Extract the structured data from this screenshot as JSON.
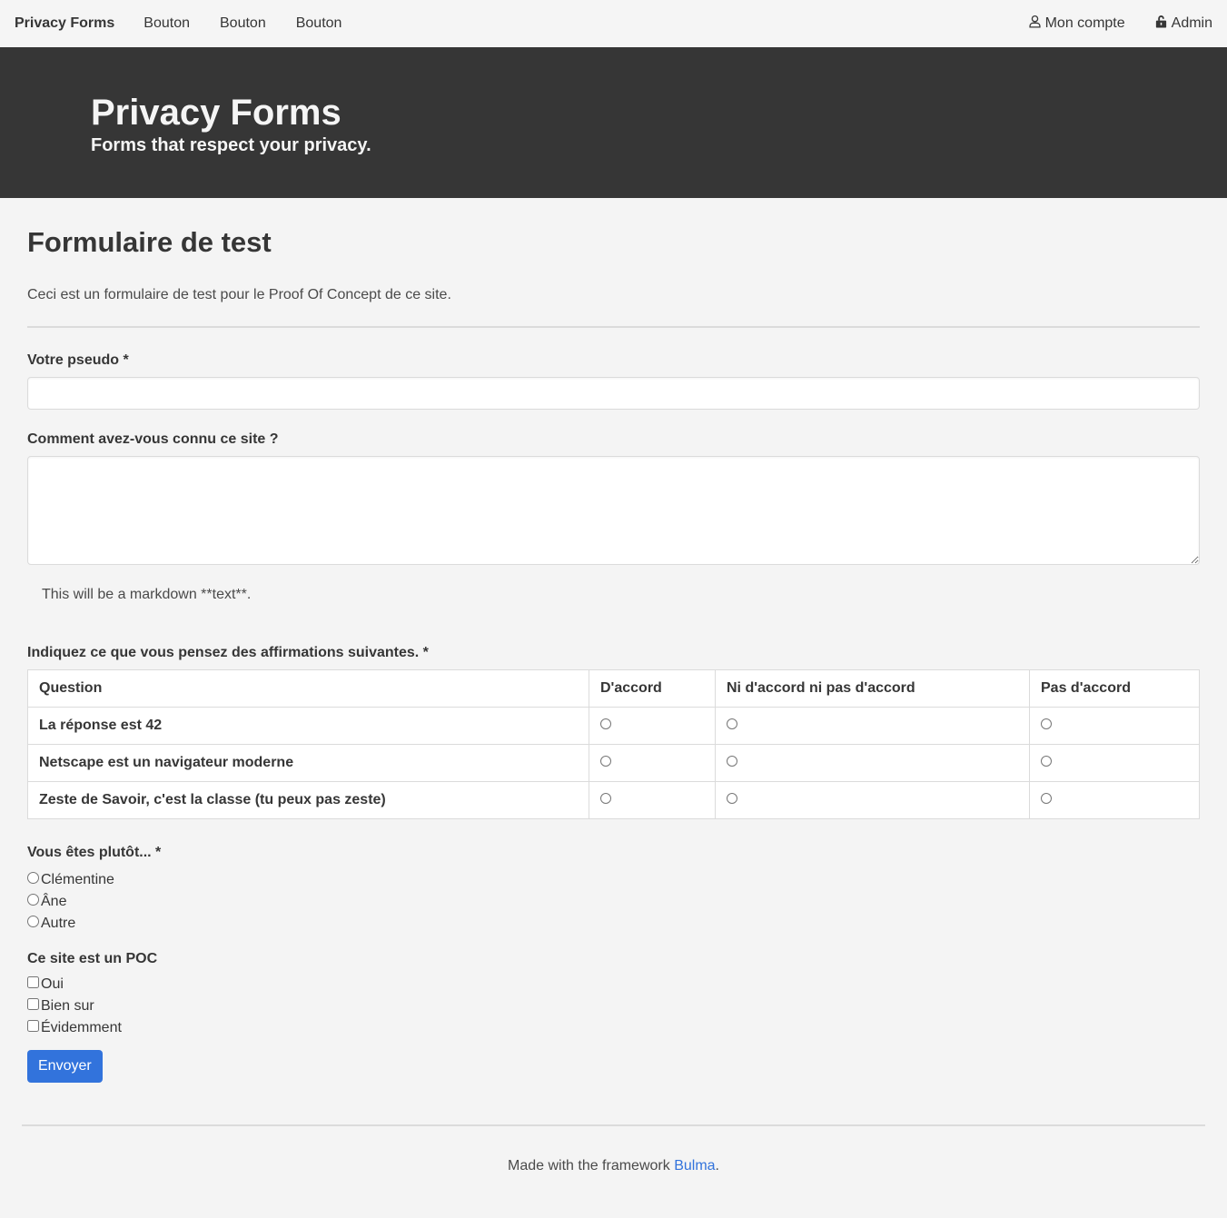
{
  "navbar": {
    "brand": "Privacy Forms",
    "items": [
      {
        "label": "Bouton"
      },
      {
        "label": "Bouton"
      },
      {
        "label": "Bouton"
      }
    ],
    "right_items": [
      {
        "label": "Mon compte",
        "icon": "user-icon"
      },
      {
        "label": "Admin",
        "icon": "unlock-icon"
      }
    ]
  },
  "hero": {
    "title": "Privacy Forms",
    "subtitle": "Forms that respect your privacy."
  },
  "form": {
    "title": "Formulaire de test",
    "description": "Ceci est un formulaire de test pour le Proof Of Concept de ce site.",
    "pseudo": {
      "label": "Votre pseudo *",
      "value": "",
      "placeholder": ""
    },
    "source": {
      "label": "Comment avez-vous connu ce site ?",
      "value": "",
      "placeholder": ""
    },
    "help_text": "This will be a markdown **text**.",
    "likert": {
      "label": "Indiquez ce que vous pensez des affirmations suivantes. *",
      "columns": [
        "Question",
        "D'accord",
        "Ni d'accord ni pas d'accord",
        "Pas d'accord"
      ],
      "rows": [
        {
          "question": "La réponse est 42"
        },
        {
          "question": "Netscape est un navigateur moderne"
        },
        {
          "question": "Zeste de Savoir, c'est la classe (tu peux pas zeste)"
        }
      ]
    },
    "radio_group": {
      "label": "Vous êtes plutôt... *",
      "options": [
        "Clémentine",
        "Âne",
        "Autre"
      ]
    },
    "checkbox_group": {
      "label": "Ce site est un POC",
      "options": [
        "Oui",
        "Bien sur",
        "Évidemment"
      ]
    },
    "submit_label": "Envoyer"
  },
  "footer": {
    "text_before": "Made with the framework ",
    "link_label": "Bulma",
    "text_after": "."
  },
  "colors": {
    "accent": "#3273dc",
    "hero_bg": "#363636",
    "page_bg": "#f4f4f4"
  }
}
